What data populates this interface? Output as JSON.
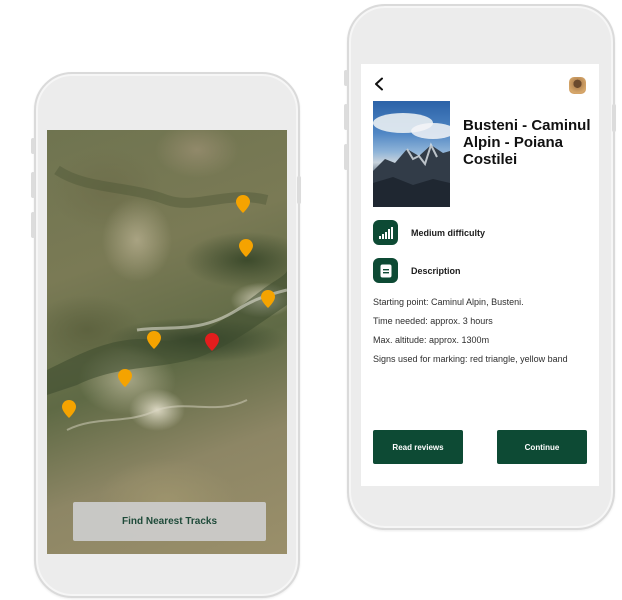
{
  "map_screen": {
    "find_button_label": "Find Nearest Tracks",
    "pin_colors": {
      "track": "#f5a300",
      "selected": "#e31d1d"
    }
  },
  "detail_screen": {
    "back_icon": "chevron-left-icon",
    "avatar_icon": "user-avatar",
    "track_title": "Busteni - Caminul Alpin - Poiana Costilei",
    "difficulty": {
      "icon": "signal-bars-icon",
      "label": "Medium difficulty"
    },
    "description": {
      "icon": "document-icon",
      "label": "Description"
    },
    "details": [
      "Starting point: Caminul Alpin, Busteni.",
      "Time needed: approx. 3 hours",
      "Max. altitude: approx. 1300m",
      "Signs used for marking: red triangle, yellow band"
    ],
    "read_reviews_label": "Read reviews",
    "continue_label": "Continue",
    "accent_color": "#0d4a34"
  }
}
